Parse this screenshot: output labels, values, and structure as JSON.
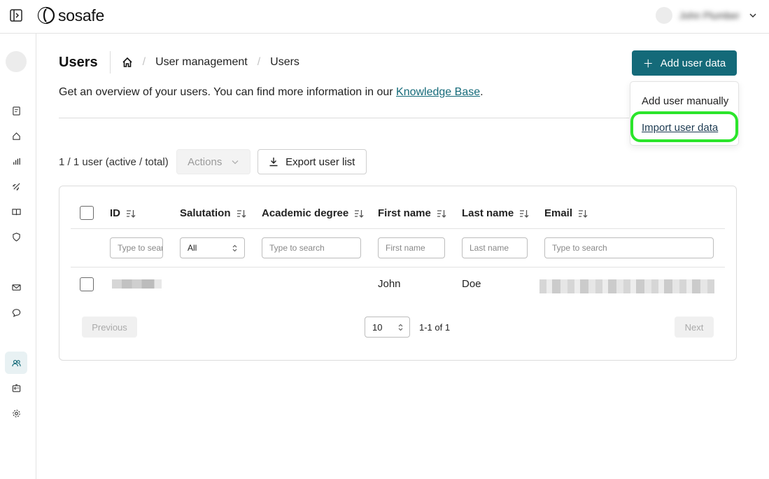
{
  "app": {
    "logo_text": "sosafe",
    "user_name": "John Plumber"
  },
  "page": {
    "title": "Users",
    "breadcrumb": [
      "User management",
      "Users"
    ],
    "add_button": "Add user data",
    "intro_text": "Get an overview of your users. You can find more information in our ",
    "intro_link": "Knowledge Base",
    "intro_end": "."
  },
  "dropdown": {
    "items": [
      "Add user manually",
      "Import user data"
    ],
    "highlight_color": "#2be52b"
  },
  "toolbar": {
    "count": "1 / 1 user (active / total)",
    "actions": "Actions",
    "export": "Export user list"
  },
  "table": {
    "columns": [
      "ID",
      "Salutation",
      "Academic degree",
      "First name",
      "Last name",
      "Email"
    ],
    "filters": {
      "id_placeholder": "Type to search",
      "salutation_value": "All",
      "degree_placeholder": "Type to search",
      "first_name_placeholder": "First name",
      "last_name_placeholder": "Last name",
      "email_placeholder": "Type to search"
    },
    "rows": [
      {
        "first_name": "John",
        "last_name": "Doe"
      }
    ]
  },
  "pagination": {
    "previous": "Previous",
    "next": "Next",
    "page_size": "10",
    "range": "1-1 of 1"
  },
  "colors": {
    "primary": "#146a79",
    "highlight": "#2be52b"
  }
}
